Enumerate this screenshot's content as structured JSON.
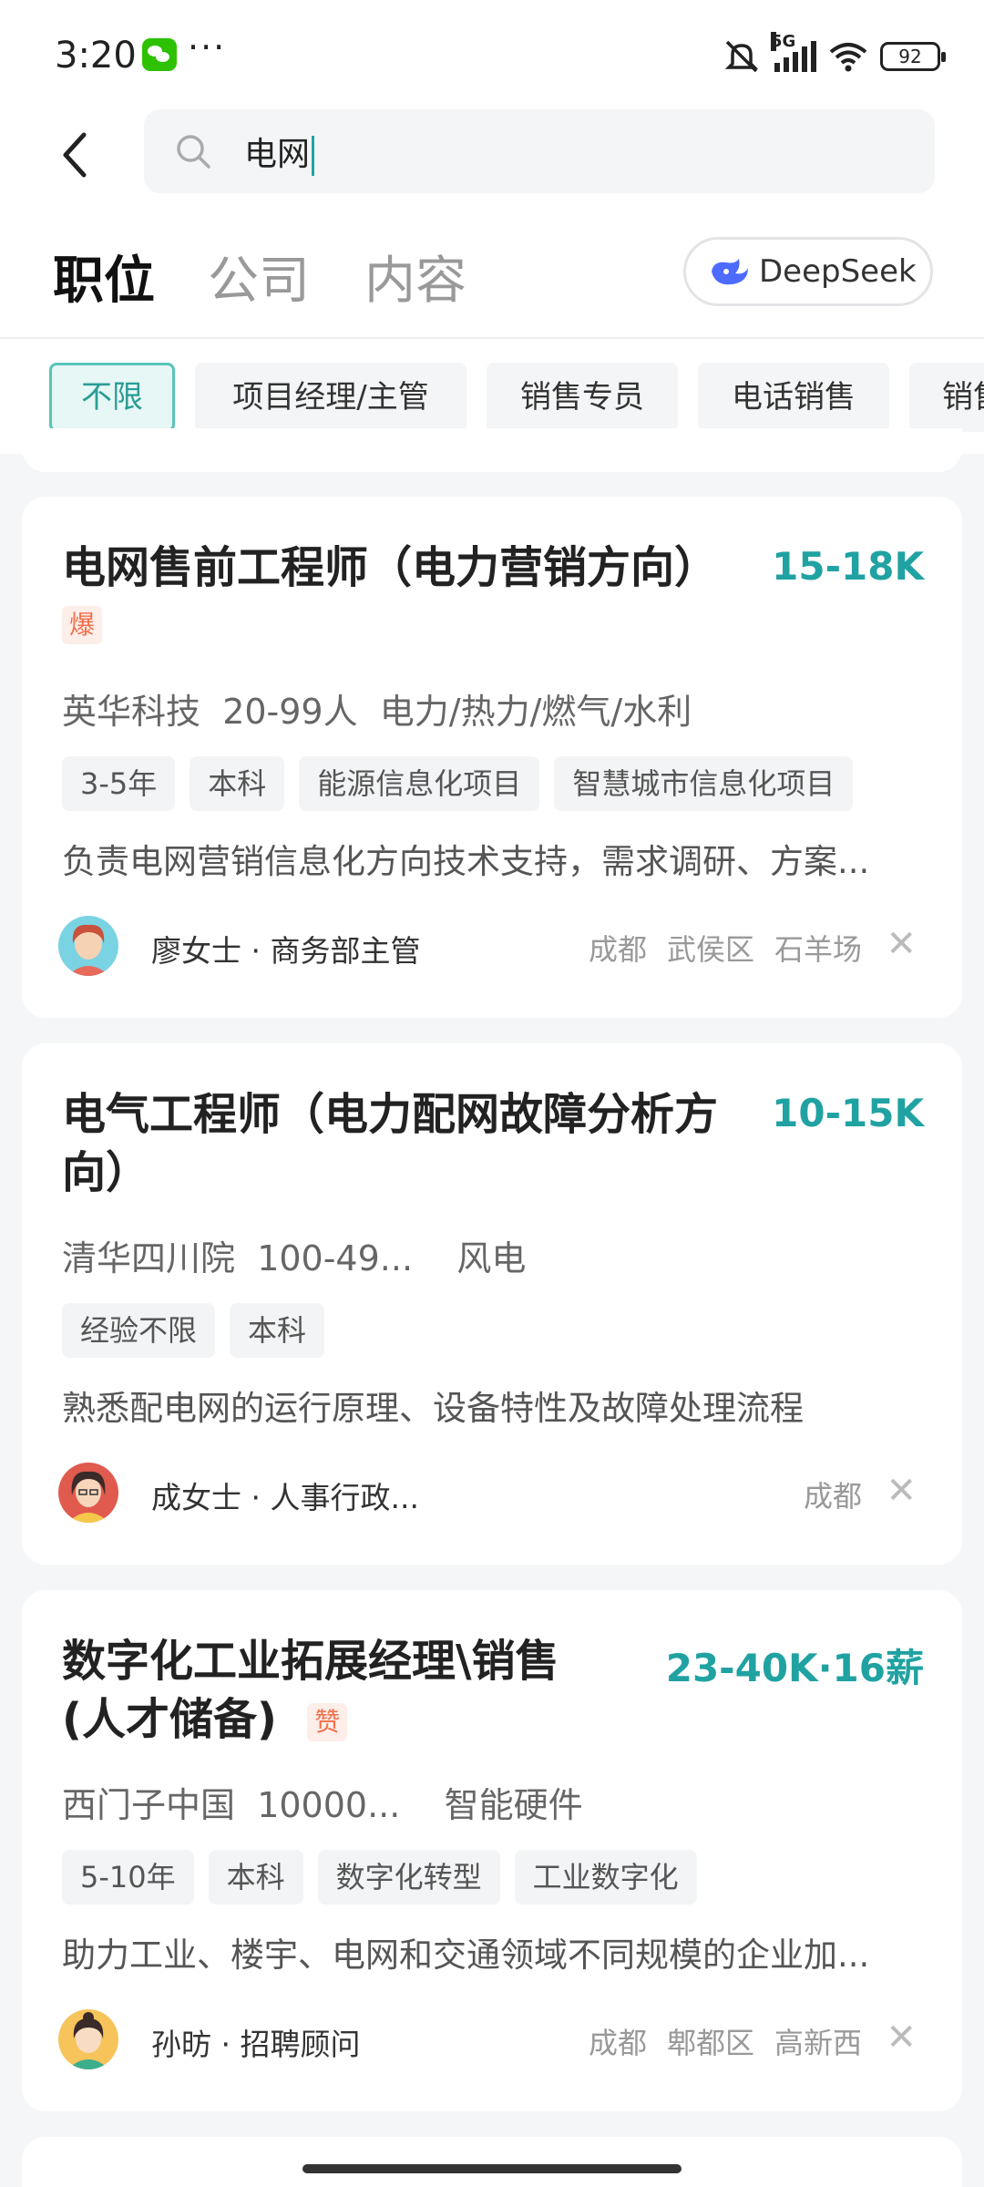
{
  "status_bar": {
    "time": "3:20",
    "network": "5G",
    "battery": "92"
  },
  "search": {
    "query": "电网"
  },
  "tabs": [
    {
      "label": "职位",
      "active": true
    },
    {
      "label": "公司",
      "active": false
    },
    {
      "label": "内容",
      "active": false
    }
  ],
  "deepseek": {
    "label": "DeepSeek"
  },
  "filters": [
    "不限",
    "项目经理/主管",
    "销售专员",
    "电话销售",
    "销售"
  ],
  "jobs": [
    {
      "title": "电网售前工程师（电力营销方向）",
      "badge": "爆",
      "salary": "15-18K",
      "company": "英华科技",
      "size": "20-99人",
      "industry": "电力/热力/燃气/水利",
      "tags": [
        "3-5年",
        "本科",
        "能源信息化项目",
        "智慧城市信息化项目"
      ],
      "desc": "负责电网营销信息化方向技术支持，需求调研、方案...",
      "recruiter": "廖女士 · 商务部主管",
      "location": [
        "成都",
        "武侯区",
        "石羊场"
      ]
    },
    {
      "title_line1": "电气工程师（电力配网故障分析方",
      "title_line2": "向）",
      "salary": "10-15K",
      "company": "清华四川院",
      "size": "100-49...",
      "industry": "风电",
      "tags": [
        "经验不限",
        "本科"
      ],
      "desc": "熟悉配电网的运行原理、设备特性及故障处理流程",
      "recruiter": "成女士 · 人事行政...",
      "location": [
        "成都"
      ]
    },
    {
      "title_line1": "数字化工业拓展经理\\销售",
      "title_line2": "(人才储备)",
      "badge": "赞",
      "salary": "23-40K·16薪",
      "company": "西门子中国",
      "size": "10000...",
      "industry": "智能硬件",
      "tags": [
        "5-10年",
        "本科",
        "数字化转型",
        "工业数字化"
      ],
      "desc": "助力工业、楼宇、电网和交通领域不同规模的企业加...",
      "recruiter": "孙昉 · 招聘顾问",
      "location": [
        "成都",
        "郫都区",
        "高新西"
      ]
    }
  ],
  "colors": {
    "accent": "#21a2a2",
    "badge": "#f0704d"
  }
}
